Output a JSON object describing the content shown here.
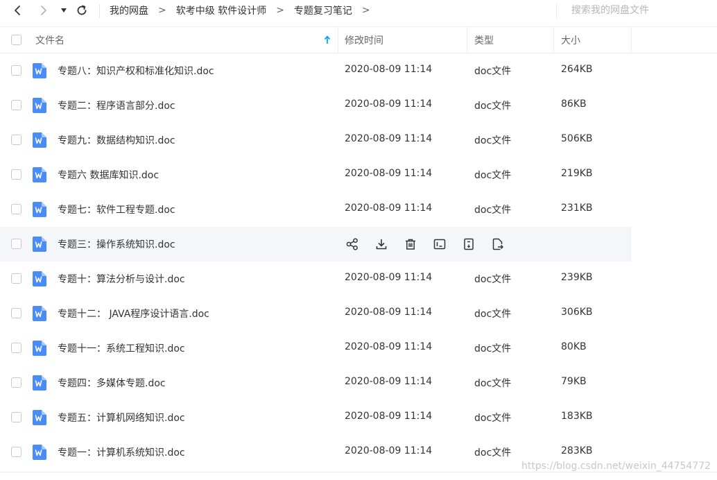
{
  "nav": {
    "breadcrumbs": [
      "我的网盘",
      "软考中级 软件设计师",
      "专题复习笔记"
    ],
    "separator": ">",
    "search_placeholder": "搜索我的网盘文件"
  },
  "header": {
    "name": "文件名",
    "sort_icon": "arrow-up-icon",
    "modified": "修改时间",
    "type": "类型",
    "size": "大小"
  },
  "files": [
    {
      "name": "专题八：知识产权和标准化知识.doc",
      "modified": "2020-08-09 11:14",
      "type": "doc文件",
      "size": "264KB"
    },
    {
      "name": "专题二：程序语言部分.doc",
      "modified": "2020-08-09 11:14",
      "type": "doc文件",
      "size": "86KB"
    },
    {
      "name": "专题九：数据结构知识.doc",
      "modified": "2020-08-09 11:14",
      "type": "doc文件",
      "size": "506KB"
    },
    {
      "name": "专题六 数据库知识.doc",
      "modified": "2020-08-09 11:14",
      "type": "doc文件",
      "size": "219KB"
    },
    {
      "name": "专题七：软件工程专题.doc",
      "modified": "2020-08-09 11:14",
      "type": "doc文件",
      "size": "231KB"
    },
    {
      "name": "专题三：操作系统知识.doc",
      "modified": "",
      "type": "",
      "size": "",
      "hovered": true
    },
    {
      "name": "专题十：算法分析与设计.doc",
      "modified": "2020-08-09 11:14",
      "type": "doc文件",
      "size": "239KB"
    },
    {
      "name": "专题十二：  JAVA程序设计语言.doc",
      "modified": "2020-08-09 11:14",
      "type": "doc文件",
      "size": "306KB"
    },
    {
      "name": "专题十一：系统工程知识.doc",
      "modified": "2020-08-09 11:14",
      "type": "doc文件",
      "size": "80KB"
    },
    {
      "name": "专题四：多媒体专题.doc",
      "modified": "2020-08-09 11:14",
      "type": "doc文件",
      "size": "79KB"
    },
    {
      "name": "专题五：计算机网络知识.doc",
      "modified": "2020-08-09 11:14",
      "type": "doc文件",
      "size": "183KB"
    },
    {
      "name": "专题一：计算机系统知识.doc",
      "modified": "2020-08-09 11:14",
      "type": "doc文件",
      "size": "283KB"
    }
  ],
  "hover_actions": [
    "share-icon",
    "download-icon",
    "delete-icon",
    "rename-icon",
    "copy-icon",
    "move-icon"
  ],
  "watermark": "https://blog.csdn.net/weixin_44754772",
  "colors": {
    "accent": "#06a7ff",
    "word_icon": "#4a8cf7"
  }
}
